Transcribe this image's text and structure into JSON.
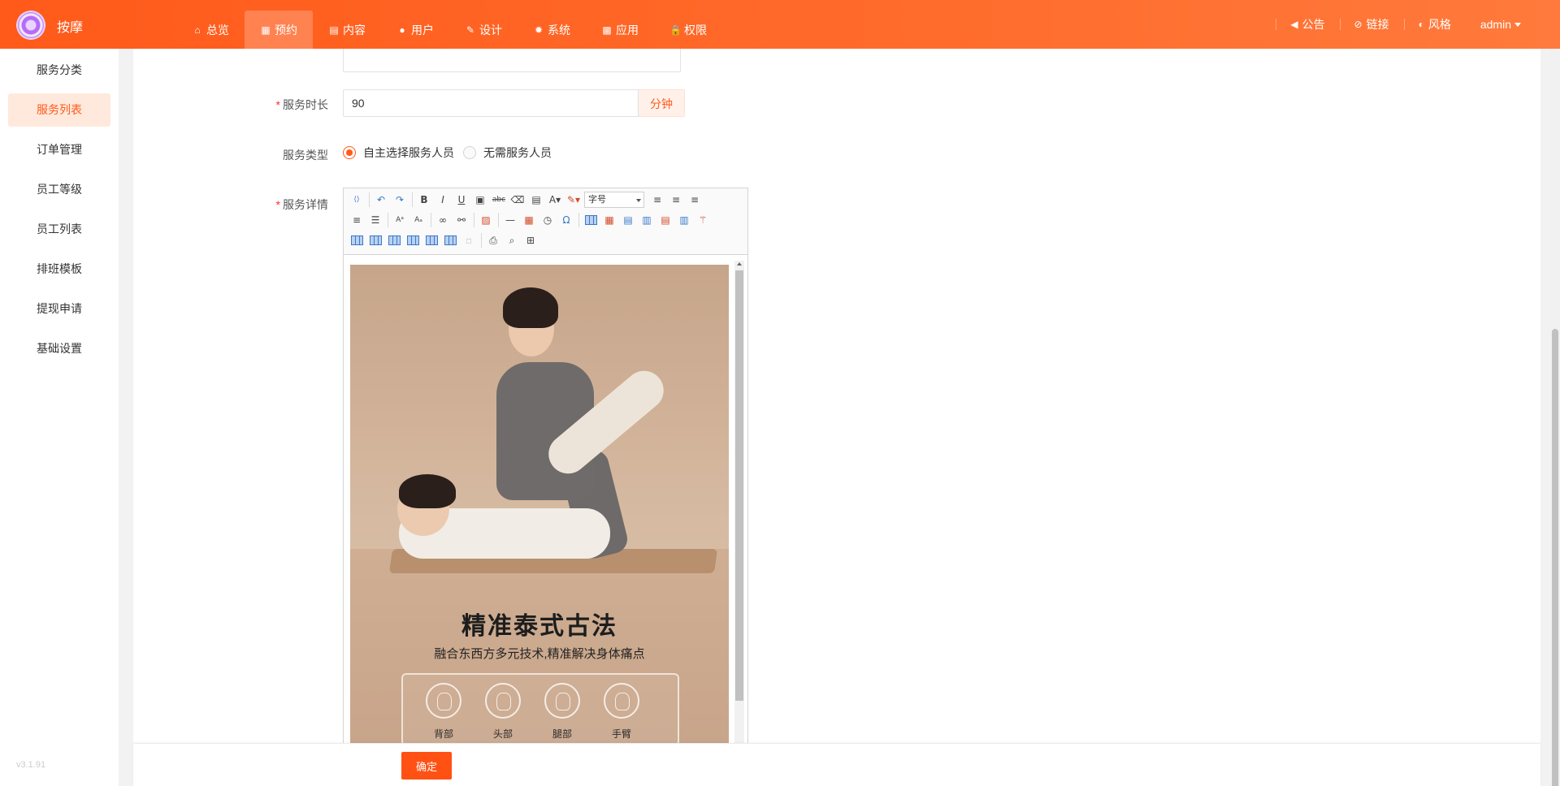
{
  "header": {
    "brand": "按摩",
    "nav": [
      {
        "label": "总览",
        "icon": "home-icon",
        "glyph": "⌂"
      },
      {
        "label": "预约",
        "icon": "calendar-icon",
        "glyph": "▦",
        "active": true
      },
      {
        "label": "内容",
        "icon": "document-icon",
        "glyph": "▤"
      },
      {
        "label": "用户",
        "icon": "user-icon",
        "glyph": "●"
      },
      {
        "label": "设计",
        "icon": "brush-icon",
        "glyph": "✎"
      },
      {
        "label": "系统",
        "icon": "gear-icon",
        "glyph": "✹"
      },
      {
        "label": "应用",
        "icon": "grid-icon",
        "glyph": "▩"
      },
      {
        "label": "权限",
        "icon": "lock-icon",
        "glyph": "🔒"
      }
    ],
    "right": [
      {
        "label": "公告",
        "icon": "speaker-icon",
        "glyph": "◀"
      },
      {
        "label": "链接",
        "icon": "link-icon",
        "glyph": "⊘"
      },
      {
        "label": "风格",
        "icon": "palette-icon",
        "glyph": "◐"
      }
    ],
    "user": "admin"
  },
  "sidebar": {
    "items": [
      {
        "label": "服务分类"
      },
      {
        "label": "服务列表",
        "active": true
      },
      {
        "label": "订单管理"
      },
      {
        "label": "员工等级"
      },
      {
        "label": "员工列表"
      },
      {
        "label": "排班模板"
      },
      {
        "label": "提现申请"
      },
      {
        "label": "基础设置"
      }
    ],
    "version": "v3.1.91"
  },
  "form": {
    "duration_label": "服务时长",
    "duration_value": "90",
    "duration_unit": "分钟",
    "type_label": "服务类型",
    "type_options": [
      "自主选择服务人员",
      "无需服务人员"
    ],
    "type_selected": 0,
    "detail_label": "服务详情",
    "font_size_select": "字号"
  },
  "poster": {
    "title": "精准泰式古法",
    "subtitle": "融合东西方多元技术,精准解决身体痛点",
    "parts": [
      "背部",
      "头部",
      "腿部",
      "手臂"
    ]
  },
  "footer": {
    "confirm_label": "确定"
  },
  "colors": {
    "accent": "#ff5a1a",
    "active_bg": "#ffe9dd"
  }
}
